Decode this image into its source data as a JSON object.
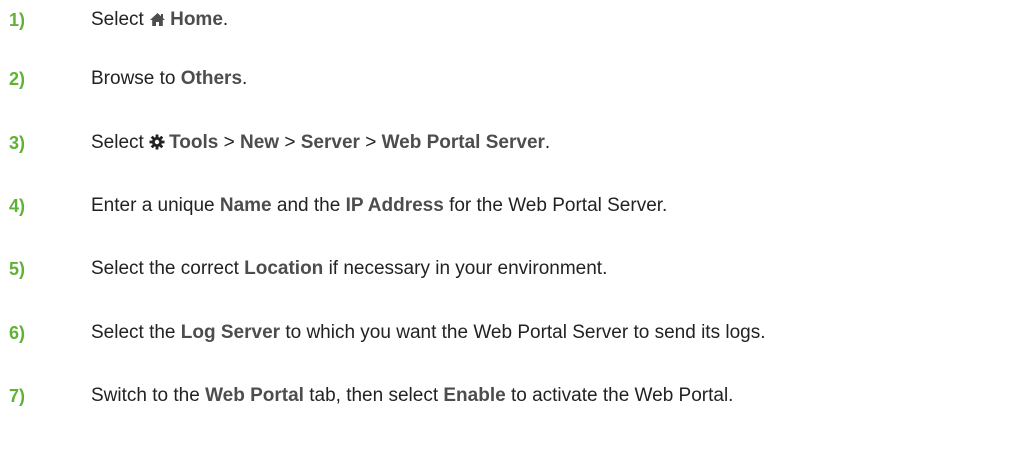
{
  "steps": [
    {
      "number": "1)",
      "segments": [
        {
          "t": "Select ",
          "b": false
        },
        {
          "icon": "home-icon"
        },
        {
          "t": "Home",
          "b": true
        },
        {
          "t": ".",
          "b": false
        }
      ]
    },
    {
      "number": "2)",
      "segments": [
        {
          "t": "Browse to ",
          "b": false
        },
        {
          "t": "Others",
          "b": true
        },
        {
          "t": ".",
          "b": false
        }
      ]
    },
    {
      "number": "3)",
      "segments": [
        {
          "t": "Select ",
          "b": false
        },
        {
          "icon": "gear-icon"
        },
        {
          "t": "Tools",
          "b": true
        },
        {
          "t": " > ",
          "b": false
        },
        {
          "t": "New",
          "b": true
        },
        {
          "t": " > ",
          "b": false
        },
        {
          "t": "Server",
          "b": true
        },
        {
          "t": " > ",
          "b": false
        },
        {
          "t": "Web Portal Server",
          "b": true
        },
        {
          "t": ".",
          "b": false
        }
      ]
    },
    {
      "number": "4)",
      "segments": [
        {
          "t": "Enter a unique ",
          "b": false
        },
        {
          "t": "Name",
          "b": true
        },
        {
          "t": " and the ",
          "b": false
        },
        {
          "t": "IP Address",
          "b": true
        },
        {
          "t": " for the Web Portal Server.",
          "b": false
        }
      ]
    },
    {
      "number": "5)",
      "segments": [
        {
          "t": "Select the correct ",
          "b": false
        },
        {
          "t": "Location",
          "b": true
        },
        {
          "t": " if necessary in your environment.",
          "b": false
        }
      ]
    },
    {
      "number": "6)",
      "segments": [
        {
          "t": "Select the ",
          "b": false
        },
        {
          "t": "Log Server",
          "b": true
        },
        {
          "t": " to which you want the Web Portal Server to send its logs.",
          "b": false
        }
      ]
    },
    {
      "number": "7)",
      "segments": [
        {
          "t": "Switch to the ",
          "b": false
        },
        {
          "t": "Web Portal",
          "b": true
        },
        {
          "t": " tab, then select ",
          "b": false
        },
        {
          "t": "Enable",
          "b": true
        },
        {
          "t": " to activate the Web Portal.",
          "b": false
        }
      ]
    }
  ],
  "colors": {
    "step_number": "#5fb233",
    "ui_term": "#4d4d4d",
    "body_text": "#222222"
  }
}
